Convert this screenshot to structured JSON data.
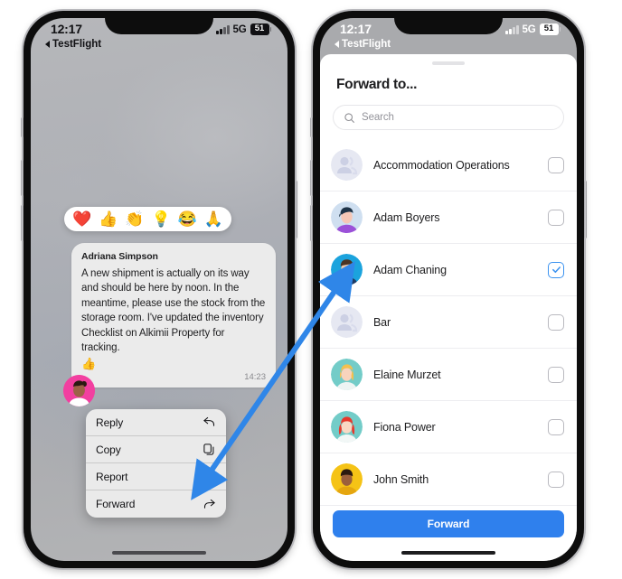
{
  "meta": {
    "accent_blue": "#2f80ed",
    "arrow_blue": "#2f86e8",
    "checkbox_blue": "#3c93f0"
  },
  "left_phone": {
    "status": {
      "time": "12:17",
      "network": "5G",
      "battery": "51",
      "signal_icon": "cellular-signal-icon",
      "battery_icon": "battery-icon"
    },
    "back_link": "TestFlight",
    "reactions": {
      "items": [
        {
          "name": "heart-emoji",
          "glyph": "❤️"
        },
        {
          "name": "thumbs-up-emoji",
          "glyph": "👍"
        },
        {
          "name": "clapping-hands-emoji",
          "glyph": "👏"
        },
        {
          "name": "lightbulb-emoji",
          "glyph": "💡"
        },
        {
          "name": "laughing-emoji",
          "glyph": "😂"
        },
        {
          "name": "praying-hands-emoji",
          "glyph": "🙏"
        }
      ]
    },
    "message": {
      "author": "Adriana Simpson",
      "text": "A new shipment is actually on its way and should be here by noon. In the meantime, please use the stock from the storage room. I've updated the inventory Checklist on Alkimii Property for tracking.",
      "reaction": "👍",
      "time": "14:23"
    },
    "context_menu": [
      {
        "label": "Reply",
        "icon": "reply-arrow-icon"
      },
      {
        "label": "Copy",
        "icon": "copy-documents-icon"
      },
      {
        "label": "Report",
        "icon": "flag-icon"
      },
      {
        "label": "Forward",
        "icon": "forward-arrow-icon"
      }
    ]
  },
  "right_phone": {
    "status": {
      "time": "12:17",
      "network": "5G",
      "battery": "51",
      "signal_icon": "cellular-signal-icon",
      "battery_icon": "battery-icon"
    },
    "back_link": "TestFlight",
    "sheet": {
      "title": "Forward to...",
      "search_placeholder": "Search",
      "search_value": "",
      "search_icon": "search-icon",
      "forward_button": "Forward",
      "contacts": [
        {
          "name": "Accommodation Operations",
          "avatar": "group",
          "checked": false
        },
        {
          "name": "Adam Boyers",
          "avatar": "adam-boyers",
          "checked": false
        },
        {
          "name": "Adam Chaning",
          "avatar": "adam-chaning",
          "checked": true
        },
        {
          "name": "Bar",
          "avatar": "group",
          "checked": false
        },
        {
          "name": "Elaine Murzet",
          "avatar": "elaine-murzet",
          "checked": false
        },
        {
          "name": "Fiona Power",
          "avatar": "fiona-power",
          "checked": false
        },
        {
          "name": "John Smith",
          "avatar": "john-smith",
          "checked": false
        }
      ]
    }
  }
}
